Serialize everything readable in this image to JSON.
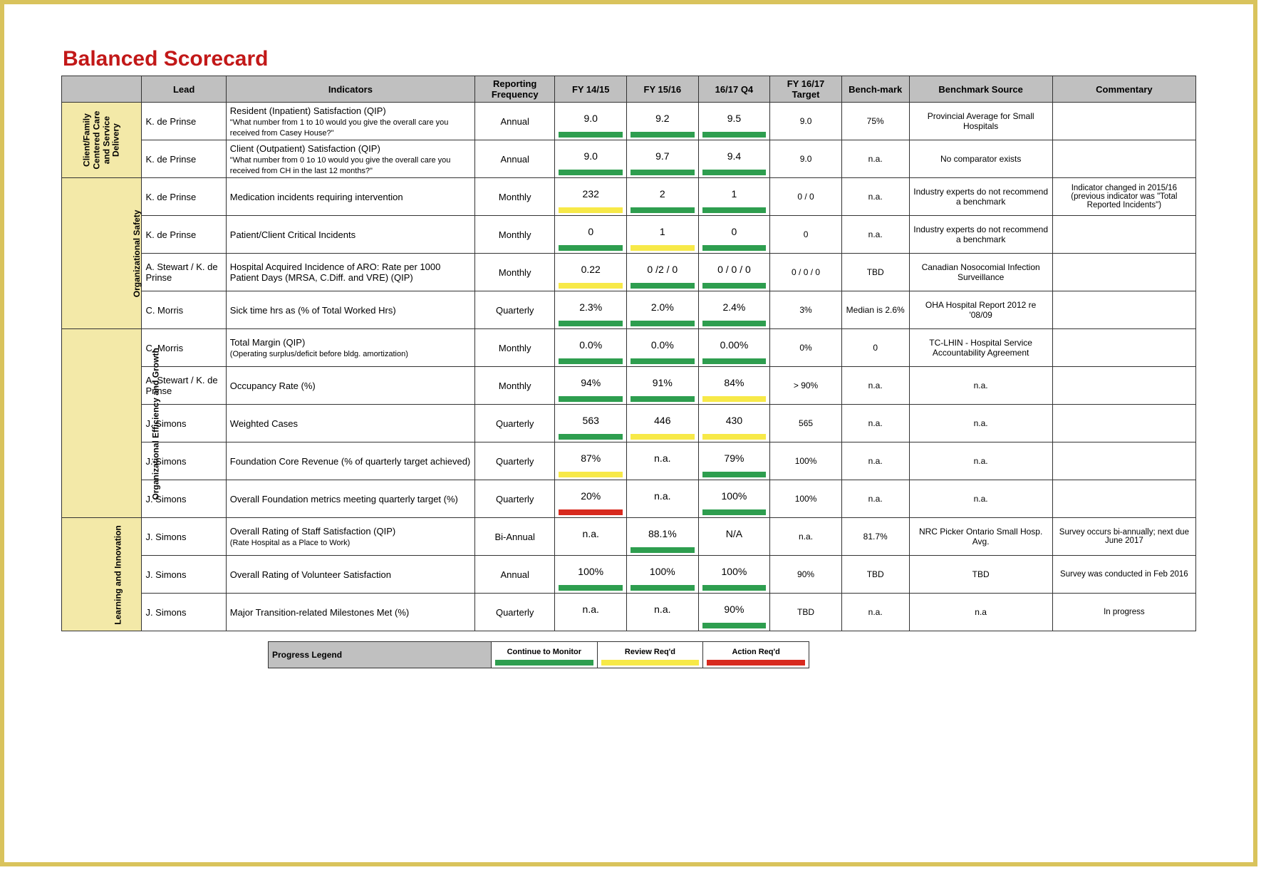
{
  "title": "Balanced Scorecard",
  "headers": {
    "lead": "Lead",
    "indicators": "Indicators",
    "freq": "Reporting Frequency",
    "fy1415": "FY 14/15",
    "fy1516": "FY 15/16",
    "q4": "16/17 Q4",
    "target": "FY 16/17 Target",
    "bench": "Bench-mark",
    "source": "Benchmark Source",
    "commentary": "Commentary"
  },
  "categories": [
    {
      "name": "Client/Family Centered Care and Service Delivery",
      "rows": [
        {
          "lead": "K. de Prinse",
          "ind": "Resident (Inpatient) Satisfaction (QIP)",
          "sub": "\"What number from 1 to 10 would you give the overall care you received from Casey House?\"",
          "freq": "Annual",
          "v1": {
            "t": "9.0",
            "c": "g"
          },
          "v2": {
            "t": "9.2",
            "c": "g"
          },
          "v3": {
            "t": "9.5",
            "c": "g"
          },
          "tgt": "9.0",
          "bm": "75%",
          "src": "Provincial Average for Small Hospitals",
          "com": ""
        },
        {
          "lead": "K. de Prinse",
          "ind": "Client (Outpatient) Satisfaction (QIP)",
          "sub": "\"What number from 0 1o 10 would you give the overall care you received from CH in the last 12 months?\"",
          "freq": "Annual",
          "v1": {
            "t": "9.0",
            "c": "g"
          },
          "v2": {
            "t": "9.7",
            "c": "g"
          },
          "v3": {
            "t": "9.4",
            "c": "g"
          },
          "tgt": "9.0",
          "bm": "n.a.",
          "src": "No comparator exists",
          "com": ""
        }
      ]
    },
    {
      "name": "Organizational Safety",
      "rows": [
        {
          "lead": "K. de Prinse",
          "ind": "Medication incidents requiring intervention",
          "sub": "",
          "freq": "Monthly",
          "v1": {
            "t": "232",
            "c": "y"
          },
          "v2": {
            "t": "2",
            "c": "g"
          },
          "v3": {
            "t": "1",
            "c": "g"
          },
          "tgt": "0 / 0",
          "bm": "n.a.",
          "src": "Industry experts do not recommend a benchmark",
          "com": "Indicator changed in 2015/16 (previous indicator was \"Total Reported Incidents\")"
        },
        {
          "lead": "K. de Prinse",
          "ind": "Patient/Client Critical Incidents",
          "sub": "",
          "freq": "Monthly",
          "v1": {
            "t": "0",
            "c": "g"
          },
          "v2": {
            "t": "1",
            "c": "y"
          },
          "v3": {
            "t": "0",
            "c": "g"
          },
          "tgt": "0",
          "bm": "n.a.",
          "src": "Industry experts do not recommend a benchmark",
          "com": ""
        },
        {
          "lead": "A. Stewart / K. de Prinse",
          "ind": "Hospital Acquired Incidence of ARO:  Rate per 1000 Patient Days (MRSA, C.Diff. and VRE) (QIP)",
          "sub": "",
          "freq": "Monthly",
          "v1": {
            "t": "0.22",
            "c": "y"
          },
          "v2": {
            "t": "0 /2 / 0",
            "c": "g"
          },
          "v3": {
            "t": "0 / 0 / 0",
            "c": "g"
          },
          "tgt": "0 / 0 / 0",
          "bm": "TBD",
          "src": "Canadian Nosocomial Infection Surveillance",
          "com": ""
        },
        {
          "lead": "C. Morris",
          "ind": "Sick time hrs as (% of Total Worked Hrs)",
          "sub": "",
          "freq": "Quarterly",
          "v1": {
            "t": "2.3%",
            "c": "g"
          },
          "v2": {
            "t": "2.0%",
            "c": "g"
          },
          "v3": {
            "t": "2.4%",
            "c": "g"
          },
          "tgt": "3%",
          "bm": "Median is 2.6%",
          "src": "OHA Hospital Report 2012 re '08/09",
          "com": ""
        }
      ]
    },
    {
      "name": "Organizational Efficiency and Growth",
      "rows": [
        {
          "lead": "C. Morris",
          "ind": "Total Margin (QIP)",
          "sub": "(Operating surplus/deficit before bldg. amortization)",
          "freq": "Monthly",
          "v1": {
            "t": "0.0%",
            "c": "g"
          },
          "v2": {
            "t": "0.0%",
            "c": "g"
          },
          "v3": {
            "t": "0.00%",
            "c": "g"
          },
          "tgt": "0%",
          "bm": "0",
          "src": "TC-LHIN - Hospital Service Accountability Agreement",
          "com": ""
        },
        {
          "lead": "A. Stewart / K. de Prinse",
          "ind": "Occupancy Rate (%)",
          "sub": "",
          "freq": "Monthly",
          "v1": {
            "t": "94%",
            "c": "g"
          },
          "v2": {
            "t": "91%",
            "c": "g"
          },
          "v3": {
            "t": "84%",
            "c": "y"
          },
          "tgt": "> 90%",
          "bm": "n.a.",
          "src": "n.a.",
          "com": ""
        },
        {
          "lead": "J. Simons",
          "ind": "Weighted Cases",
          "sub": "",
          "freq": "Quarterly",
          "v1": {
            "t": "563",
            "c": "g"
          },
          "v2": {
            "t": "446",
            "c": "y"
          },
          "v3": {
            "t": "430",
            "c": "y"
          },
          "tgt": "565",
          "bm": "n.a.",
          "src": "n.a.",
          "com": ""
        },
        {
          "lead": "J. Simons",
          "ind": "Foundation Core Revenue (% of quarterly target achieved)",
          "sub": "",
          "freq": "Quarterly",
          "v1": {
            "t": "87%",
            "c": "y"
          },
          "v2": {
            "t": "n.a.",
            "c": "n"
          },
          "v3": {
            "t": "79%",
            "c": "g"
          },
          "tgt": "100%",
          "bm": "n.a.",
          "src": "n.a.",
          "com": ""
        },
        {
          "lead": "J. Simons",
          "ind": "Overall Foundation metrics meeting quarterly target (%)",
          "sub": "",
          "freq": "Quarterly",
          "v1": {
            "t": "20%",
            "c": "r"
          },
          "v2": {
            "t": "n.a.",
            "c": "n"
          },
          "v3": {
            "t": "100%",
            "c": "g"
          },
          "tgt": "100%",
          "bm": "n.a.",
          "src": "n.a.",
          "com": ""
        }
      ]
    },
    {
      "name": "Learning and Innovation",
      "rows": [
        {
          "lead": "J. Simons",
          "ind": "Overall Rating of Staff Satisfaction (QIP)",
          "sub": "(Rate Hospital as a Place to Work)",
          "freq": "Bi-Annual",
          "v1": {
            "t": "n.a.",
            "c": "n"
          },
          "v2": {
            "t": "88.1%",
            "c": "g"
          },
          "v3": {
            "t": "N/A",
            "c": "n"
          },
          "tgt": "n.a.",
          "bm": "81.7%",
          "src": "NRC Picker\nOntario Small Hosp. Avg.",
          "com": "Survey occurs bi-annually; next due June 2017"
        },
        {
          "lead": "J. Simons",
          "ind": "Overall Rating of Volunteer Satisfaction",
          "sub": "",
          "freq": "Annual",
          "v1": {
            "t": "100%",
            "c": "g"
          },
          "v2": {
            "t": "100%",
            "c": "g"
          },
          "v3": {
            "t": "100%",
            "c": "g"
          },
          "tgt": "90%",
          "bm": "TBD",
          "src": "TBD",
          "com": "Survey was conducted in Feb 2016"
        },
        {
          "lead": "J. Simons",
          "ind": "Major Transition-related Milestones Met (%)",
          "sub": "",
          "freq": "Quarterly",
          "v1": {
            "t": "n.a.",
            "c": "n"
          },
          "v2": {
            "t": "n.a.",
            "c": "n"
          },
          "v3": {
            "t": "90%",
            "c": "g"
          },
          "tgt": "TBD",
          "bm": "n.a.",
          "src": "n.a",
          "com": "In progress"
        }
      ]
    }
  ],
  "legend": {
    "label": "Progress Legend",
    "items": [
      {
        "t": "Continue to Monitor",
        "c": "g"
      },
      {
        "t": "Review Req'd",
        "c": "y"
      },
      {
        "t": "Action Req'd",
        "c": "r"
      }
    ]
  }
}
